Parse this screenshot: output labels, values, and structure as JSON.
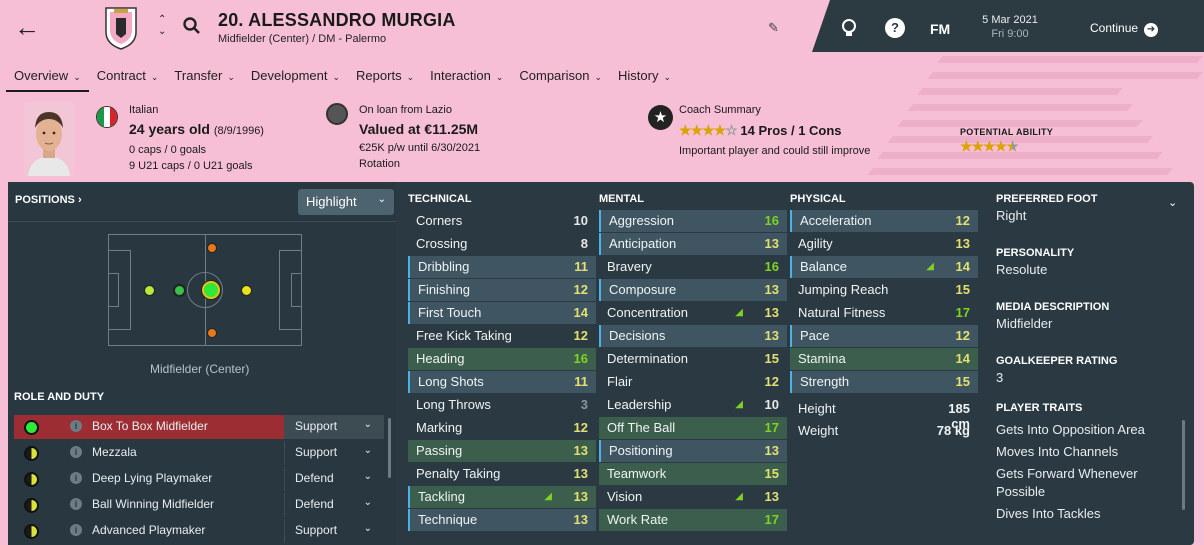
{
  "header": {
    "player_name": "20. ALESSANDRO MURGIA",
    "subtitle": "Midfielder (Center) / DM - Palermo",
    "date_line1": "5 Mar 2021",
    "date_line2": "Fri 9:00",
    "continue_label": "Continue",
    "fm_label": "FM",
    "help_label": "?"
  },
  "tabs": [
    "Overview",
    "Contract",
    "Transfer",
    "Development",
    "Reports",
    "Interaction",
    "Comparison",
    "History"
  ],
  "bio": {
    "nationality": "Italian",
    "age": "24 years old",
    "dob": "(8/9/1996)",
    "caps": "0 caps / 0 goals",
    "u21caps": "9 U21 caps / 0 U21 goals"
  },
  "loan": {
    "line1": "On loan from Lazio",
    "value": "Valued at €11.25M",
    "wage": "€25K p/w until 6/30/2021",
    "status": "Rotation"
  },
  "coach": {
    "title": "Coach Summary",
    "pros": "14 Pros / 1 Cons",
    "stars": 4.0,
    "note": "Important player and could still improve",
    "pa_label": "POTENTIAL ABILITY",
    "pa_stars": 4.5
  },
  "positions": {
    "header": "POSITIONS ›",
    "highlight": "Highlight",
    "label": "Midfielder (Center)"
  },
  "roles": {
    "header": "ROLE AND DUTY",
    "items": [
      {
        "name": "Box To Box Midfielder",
        "duty": "Support"
      },
      {
        "name": "Mezzala",
        "duty": "Support"
      },
      {
        "name": "Deep Lying Playmaker",
        "duty": "Defend"
      },
      {
        "name": "Ball Winning Midfielder",
        "duty": "Defend"
      },
      {
        "name": "Advanced Playmaker",
        "duty": "Support"
      }
    ]
  },
  "technical": {
    "header": "TECHNICAL",
    "items": [
      {
        "name": "Corners",
        "value": "10"
      },
      {
        "name": "Crossing",
        "value": "8"
      },
      {
        "name": "Dribbling",
        "value": "11"
      },
      {
        "name": "Finishing",
        "value": "12"
      },
      {
        "name": "First Touch",
        "value": "14"
      },
      {
        "name": "Free Kick Taking",
        "value": "12"
      },
      {
        "name": "Heading",
        "value": "16"
      },
      {
        "name": "Long Shots",
        "value": "11"
      },
      {
        "name": "Long Throws",
        "value": "3"
      },
      {
        "name": "Marking",
        "value": "12"
      },
      {
        "name": "Passing",
        "value": "13"
      },
      {
        "name": "Penalty Taking",
        "value": "13"
      },
      {
        "name": "Tackling",
        "value": "13"
      },
      {
        "name": "Technique",
        "value": "13"
      }
    ]
  },
  "mental": {
    "header": "MENTAL",
    "items": [
      {
        "name": "Aggression",
        "value": "16"
      },
      {
        "name": "Anticipation",
        "value": "13"
      },
      {
        "name": "Bravery",
        "value": "16"
      },
      {
        "name": "Composure",
        "value": "13"
      },
      {
        "name": "Concentration",
        "value": "13"
      },
      {
        "name": "Decisions",
        "value": "13"
      },
      {
        "name": "Determination",
        "value": "15"
      },
      {
        "name": "Flair",
        "value": "12"
      },
      {
        "name": "Leadership",
        "value": "10"
      },
      {
        "name": "Off The Ball",
        "value": "17"
      },
      {
        "name": "Positioning",
        "value": "13"
      },
      {
        "name": "Teamwork",
        "value": "15"
      },
      {
        "name": "Vision",
        "value": "13"
      },
      {
        "name": "Work Rate",
        "value": "17"
      }
    ]
  },
  "physical": {
    "header": "PHYSICAL",
    "items": [
      {
        "name": "Acceleration",
        "value": "12"
      },
      {
        "name": "Agility",
        "value": "13"
      },
      {
        "name": "Balance",
        "value": "14"
      },
      {
        "name": "Jumping Reach",
        "value": "15"
      },
      {
        "name": "Natural Fitness",
        "value": "17"
      },
      {
        "name": "Pace",
        "value": "12"
      },
      {
        "name": "Stamina",
        "value": "14"
      },
      {
        "name": "Strength",
        "value": "15"
      }
    ],
    "height_label": "Height",
    "height": "185 cm",
    "weight_label": "Weight",
    "weight": "78 kg"
  },
  "details": {
    "foot_label": "PREFERRED FOOT",
    "foot": "Right",
    "personality_label": "PERSONALITY",
    "personality": "Resolute",
    "media_label": "MEDIA DESCRIPTION",
    "media": "Midfielder",
    "gk_label": "GOALKEEPER RATING",
    "gk": "3",
    "traits_label": "PLAYER TRAITS",
    "traits": [
      "Gets Into Opposition Area",
      "Moves Into Channels",
      "Gets Forward Whenever Possible",
      "Dives Into Tackles"
    ]
  },
  "colors": {
    "background": "#f6bfd5",
    "panel": "#2b3a42",
    "selected_role": "#9c2d33",
    "good_value": "#7ed321",
    "mid_value": "#e3e070"
  }
}
